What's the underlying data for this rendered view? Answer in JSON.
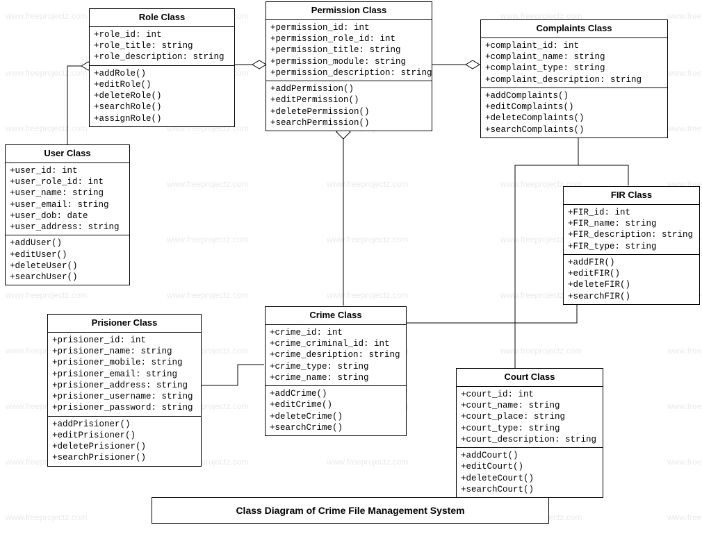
{
  "chart_data": {
    "type": "uml_class_diagram",
    "title": "Class Diagram of Crime File Management System",
    "classes": [
      {
        "name": "Role Class",
        "attributes": [
          "+role_id: int",
          "+role_title: string",
          "+role_description: string"
        ],
        "methods": [
          "+addRole()",
          "+editRole()",
          "+deleteRole()",
          "+searchRole()",
          "+assignRole()"
        ]
      },
      {
        "name": "Permission Class",
        "attributes": [
          "+permission_id: int",
          "+permission_role_id: int",
          "+permission_title: string",
          "+permission_module: string",
          "+permission_description: string"
        ],
        "methods": [
          "+addPermission()",
          "+editPermission()",
          "+deletePermission()",
          "+searchPermission()"
        ]
      },
      {
        "name": "Complaints Class",
        "attributes": [
          "+complaint_id: int",
          "+complaint_name: string",
          "+complaint_type: string",
          "+complaint_description: string"
        ],
        "methods": [
          "+addComplaints()",
          "+editComplaints()",
          "+deleteComplaints()",
          "+searchComplaints()"
        ]
      },
      {
        "name": "User Class",
        "attributes": [
          "+user_id: int",
          "+user_role_id: int",
          "+user_name: string",
          "+user_email: string",
          "+user_dob: date",
          "+user_address: string"
        ],
        "methods": [
          "+addUser()",
          "+editUser()",
          "+deleteUser()",
          "+searchUser()"
        ]
      },
      {
        "name": "FIR Class",
        "attributes": [
          "+FIR_id: int",
          "+FIR_name: string",
          "+FIR_description: string",
          "+FIR_type: string"
        ],
        "methods": [
          "+addFIR()",
          "+editFIR()",
          "+deleteFIR()",
          "+searchFIR()"
        ]
      },
      {
        "name": "Prisioner Class",
        "attributes": [
          "+prisioner_id: int",
          "+prisioner_name: string",
          "+prisioner_mobile: string",
          "+prisioner_email: string",
          "+prisioner_address: string",
          "+prisioner_username: string",
          "+prisioner_password: string"
        ],
        "methods": [
          "+addPrisioner()",
          "+editPrisioner()",
          "+deletePrisioner()",
          "+searchPrisioner()"
        ]
      },
      {
        "name": "Crime Class",
        "attributes": [
          "+crime_id: int",
          "+crime_criminal_id: int",
          "+crime_desription: string",
          "+crime_type: string",
          "+crime_name: string"
        ],
        "methods": [
          "+addCrime()",
          "+editCrime()",
          "+deleteCrime()",
          "+searchCrime()"
        ]
      },
      {
        "name": "Court Class",
        "attributes": [
          "+court_id: int",
          "+court_name: string",
          "+court_place: string",
          "+court_type: string",
          "+court_description: string"
        ],
        "methods": [
          "+addCourt()",
          "+editCourt()",
          "+deleteCourt()",
          "+searchCourt()"
        ]
      }
    ],
    "relations": [
      {
        "from": "User Class",
        "to": "Role Class",
        "type": "aggregation"
      },
      {
        "from": "Role Class",
        "to": "Permission Class",
        "type": "aggregation"
      },
      {
        "from": "Permission Class",
        "to": "Complaints Class",
        "type": "aggregation"
      },
      {
        "from": "Permission Class",
        "to": "Crime Class",
        "type": "aggregation"
      },
      {
        "from": "Complaints Class",
        "to": "FIR Class",
        "type": "association"
      },
      {
        "from": "Complaints Class",
        "to": "Court Class",
        "type": "association"
      },
      {
        "from": "Crime Class",
        "to": "Prisioner Class",
        "type": "association"
      },
      {
        "from": "FIR Class",
        "to": "Crime Class",
        "type": "association"
      }
    ]
  },
  "classes": {
    "role": {
      "title": "Role Class",
      "attrs": [
        "+role_id: int",
        "+role_title: string",
        "+role_description: string"
      ],
      "methods": [
        "+addRole()",
        "+editRole()",
        "+deleteRole()",
        "+searchRole()",
        "+assignRole()"
      ]
    },
    "permission": {
      "title": "Permission Class",
      "attrs": [
        "+permission_id: int",
        "+permission_role_id: int",
        "+permission_title: string",
        "+permission_module: string",
        "+permission_description: string"
      ],
      "methods": [
        "+addPermission()",
        "+editPermission()",
        "+deletePermission()",
        "+searchPermission()"
      ]
    },
    "complaints": {
      "title": "Complaints Class",
      "attrs": [
        "+complaint_id: int",
        "+complaint_name: string",
        "+complaint_type: string",
        "+complaint_description: string"
      ],
      "methods": [
        "+addComplaints()",
        "+editComplaints()",
        "+deleteComplaints()",
        "+searchComplaints()"
      ]
    },
    "user": {
      "title": "User Class",
      "attrs": [
        "+user_id: int",
        "+user_role_id: int",
        "+user_name: string",
        "+user_email: string",
        "+user_dob: date",
        "+user_address: string"
      ],
      "methods": [
        "+addUser()",
        "+editUser()",
        "+deleteUser()",
        "+searchUser()"
      ]
    },
    "fir": {
      "title": "FIR Class",
      "attrs": [
        "+FIR_id: int",
        "+FIR_name: string",
        "+FIR_description: string",
        "+FIR_type: string"
      ],
      "methods": [
        "+addFIR()",
        "+editFIR()",
        "+deleteFIR()",
        "+searchFIR()"
      ]
    },
    "prisioner": {
      "title": "Prisioner Class",
      "attrs": [
        "+prisioner_id: int",
        "+prisioner_name: string",
        "+prisioner_mobile: string",
        "+prisioner_email: string",
        "+prisioner_address: string",
        "+prisioner_username: string",
        "+prisioner_password: string"
      ],
      "methods": [
        "+addPrisioner()",
        "+editPrisioner()",
        "+deletePrisioner()",
        "+searchPrisioner()"
      ]
    },
    "crime": {
      "title": "Crime Class",
      "attrs": [
        "+crime_id: int",
        "+crime_criminal_id: int",
        "+crime_desription: string",
        "+crime_type: string",
        "+crime_name: string"
      ],
      "methods": [
        "+addCrime()",
        "+editCrime()",
        "+deleteCrime()",
        "+searchCrime()"
      ]
    },
    "court": {
      "title": "Court Class",
      "attrs": [
        "+court_id: int",
        "+court_name: string",
        "+court_place: string",
        "+court_type: string",
        "+court_description: string"
      ],
      "methods": [
        "+addCourt()",
        "+editCourt()",
        "+deleteCourt()",
        "+searchCourt()"
      ]
    }
  },
  "title": "Class Diagram of Crime File Management System",
  "watermark_text": "www.freeprojectz.com"
}
